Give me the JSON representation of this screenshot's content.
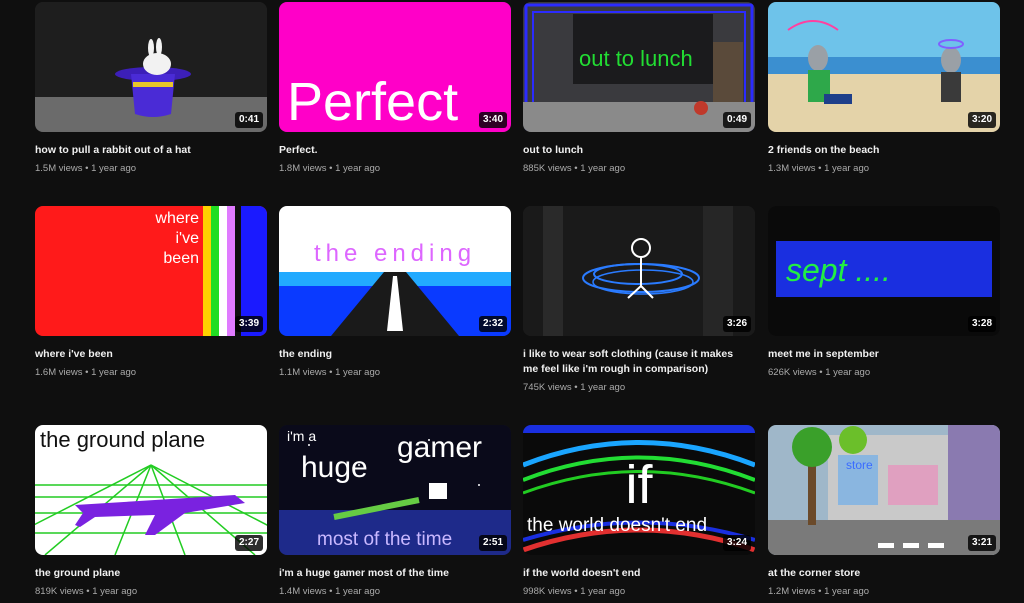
{
  "videos": [
    {
      "title": "how to pull a rabbit out of a hat",
      "views": "1.5M views",
      "age": "1 year ago",
      "duration": "0:41",
      "overlay": ""
    },
    {
      "title": "Perfect.",
      "views": "1.8M views",
      "age": "1 year ago",
      "duration": "3:40",
      "overlay": "Perfect"
    },
    {
      "title": "out to lunch",
      "views": "885K views",
      "age": "1 year ago",
      "duration": "0:49",
      "overlay": "out to lunch"
    },
    {
      "title": "2 friends on the beach",
      "views": "1.3M views",
      "age": "1 year ago",
      "duration": "3:20",
      "overlay": ""
    },
    {
      "title": "where i've been",
      "views": "1.6M views",
      "age": "1 year ago",
      "duration": "3:39",
      "overlay": [
        "where",
        "i've",
        "been"
      ]
    },
    {
      "title": "the ending",
      "views": "1.1M views",
      "age": "1 year ago",
      "duration": "2:32",
      "overlay": "the ending"
    },
    {
      "title": "i like to wear soft clothing (cause it makes me feel like i'm rough in comparison)",
      "views": "745K views",
      "age": "1 year ago",
      "duration": "3:26",
      "overlay": ""
    },
    {
      "title": "meet me in september",
      "views": "626K views",
      "age": "1 year ago",
      "duration": "3:28",
      "overlay": "sept ...."
    },
    {
      "title": "the ground plane",
      "views": "819K views",
      "age": "1 year ago",
      "duration": "2:27",
      "overlay": "the ground plane"
    },
    {
      "title": "i'm a huge gamer most of the time",
      "views": "1.4M views",
      "age": "1 year ago",
      "duration": "2:51",
      "overlay": [
        "i'm a",
        "huge",
        "gamer",
        "most of the time"
      ]
    },
    {
      "title": "if the world doesn't end",
      "views": "998K views",
      "age": "1 year ago",
      "duration": "3:24",
      "overlay": [
        "if",
        "the world doesn't end"
      ]
    },
    {
      "title": "at the corner store",
      "views": "1.2M views",
      "age": "1 year ago",
      "duration": "3:21",
      "overlay": "store"
    }
  ],
  "separator": "•"
}
